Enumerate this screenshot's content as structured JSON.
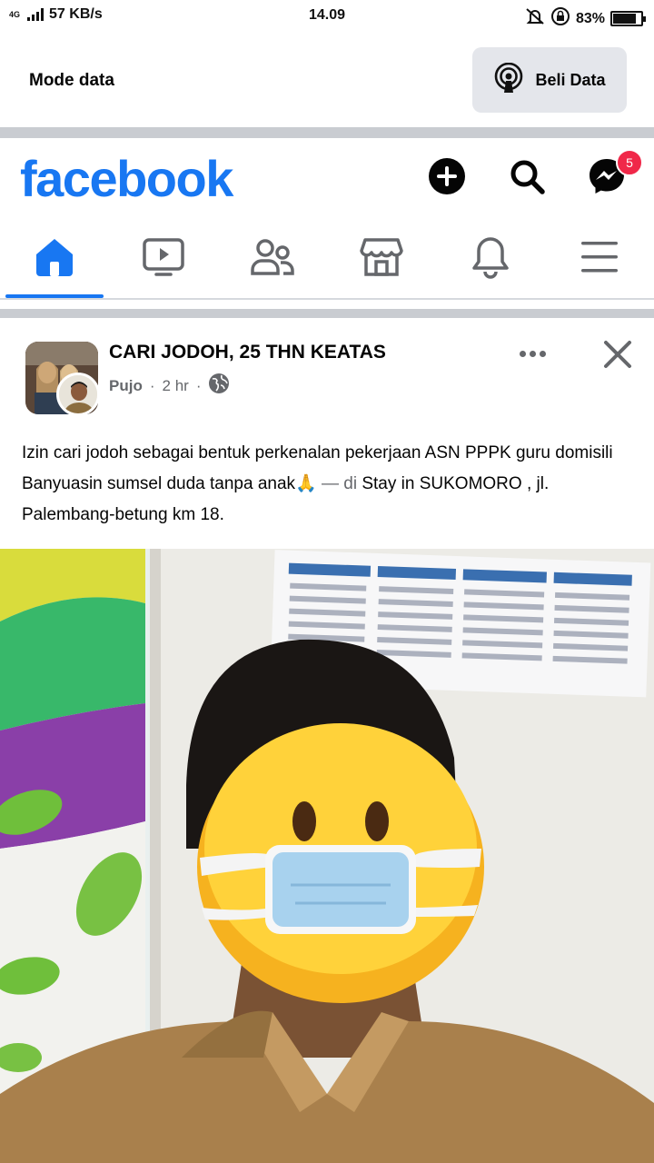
{
  "status_bar": {
    "network_type": "4G",
    "speed": "57 KB/s",
    "time": "14.09",
    "battery": "83%",
    "battery_level": 0.83
  },
  "data_bar": {
    "label": "Mode data",
    "buy_button": "Beli Data"
  },
  "header": {
    "logo": "facebook",
    "messenger_badge": "5"
  },
  "tabs": [
    {
      "name": "home",
      "active": true
    },
    {
      "name": "video",
      "active": false
    },
    {
      "name": "friends",
      "active": false
    },
    {
      "name": "marketplace",
      "active": false
    },
    {
      "name": "notifications",
      "active": false
    },
    {
      "name": "menu",
      "active": false
    }
  ],
  "post": {
    "group_name": "CARI JODOH, 25 THN KEATAS",
    "author": "Pujo",
    "time": "2 hr",
    "text_main": "Izin cari jodoh sebagai bentuk perkenalan pekerjaan ASN PPPK guru domisili Banyuasin sumsel duda tanpa anak",
    "text_emoji": "🙏",
    "text_dash": " — di",
    "text_location": " Stay in SUKOMORO , jl. Palembang-betung km 18",
    "text_end": "."
  },
  "colors": {
    "brand": "#1877f2",
    "badge": "#f02849",
    "muted": "#65676b"
  }
}
